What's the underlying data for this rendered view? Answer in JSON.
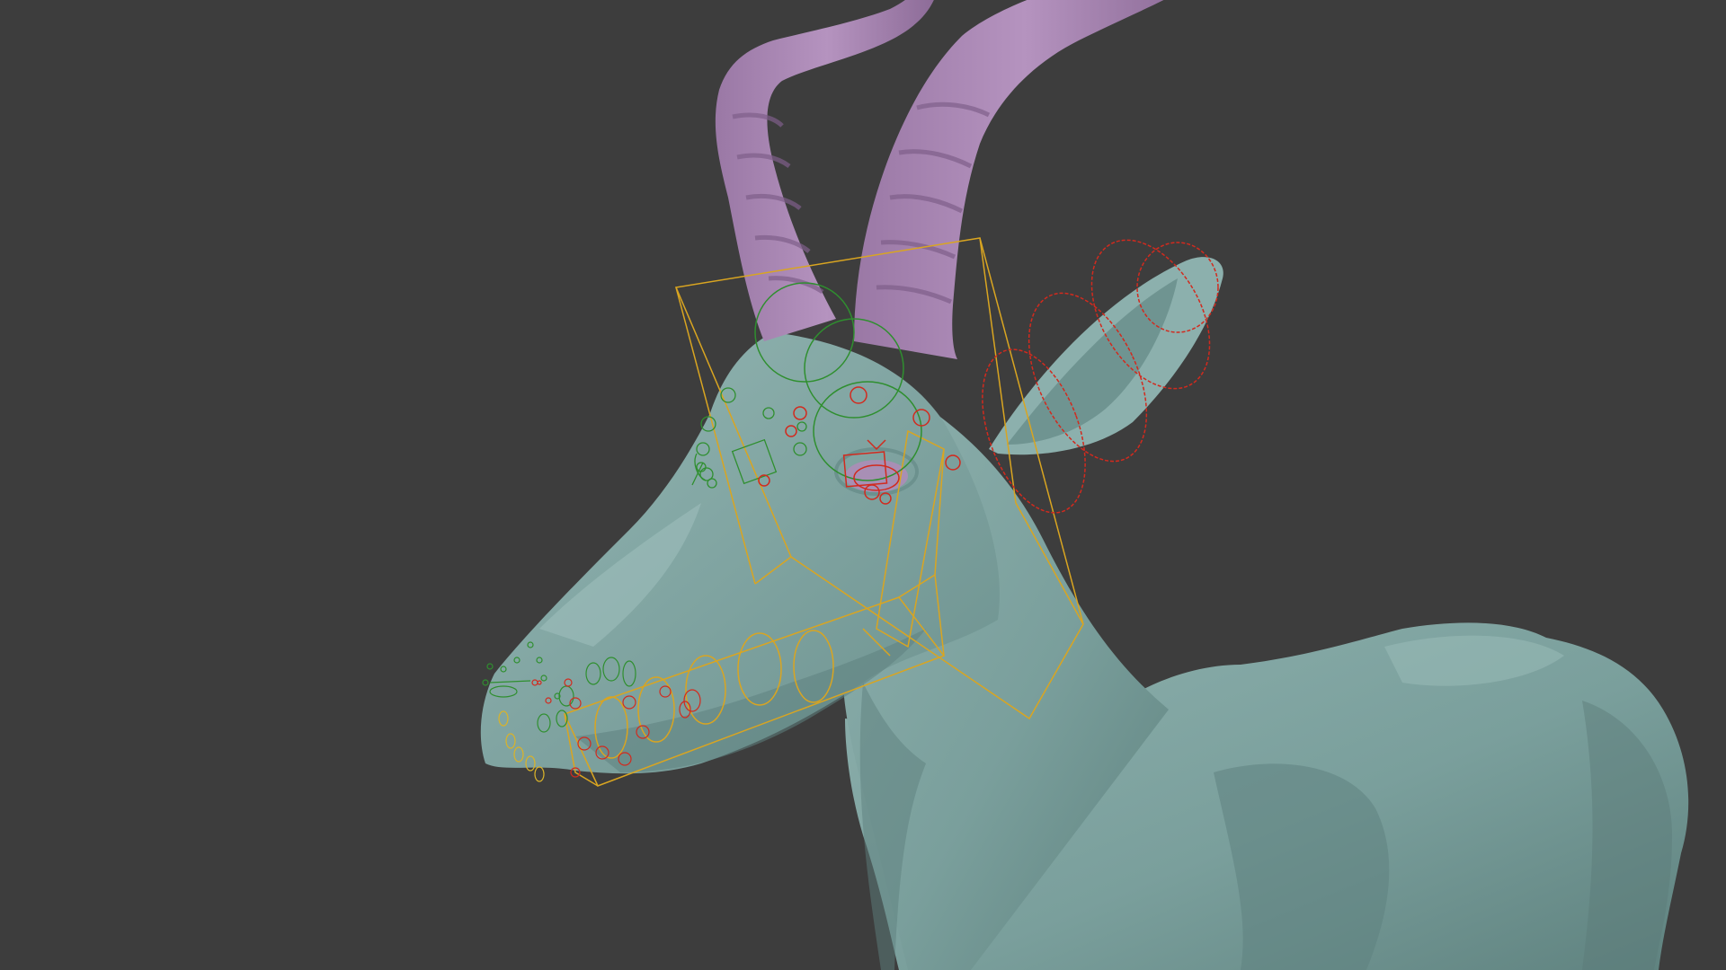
{
  "viewport": {
    "background_color": "#3d3d3d",
    "mesh_body_color": "#7fa3a0",
    "mesh_shadow_color": "#5d7f7d",
    "horn_color": "#a986b3",
    "horn_shadow_color": "#8a6a95"
  },
  "rig_overlay": {
    "bounding_box_color": "#d9a521",
    "control_colors": {
      "left": "#2f8f2f",
      "right": "#d22a1e",
      "center": "#d9b32a"
    }
  }
}
